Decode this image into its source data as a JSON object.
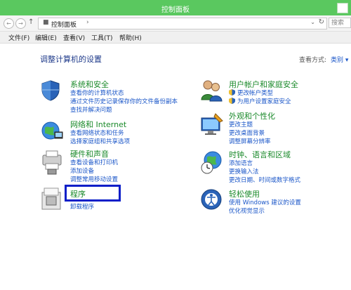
{
  "window": {
    "title": "控制面板"
  },
  "address": {
    "crumb": "控制面板",
    "search_placeholder": "搜索"
  },
  "menu": [
    "文件(F)",
    "编辑(E)",
    "查看(V)",
    "工具(T)",
    "帮助(H)"
  ],
  "content": {
    "heading": "调整计算机的设置",
    "view_by_label": "查看方式:",
    "view_by_value": "类别 ▾"
  },
  "categories": {
    "system": {
      "title": "系统和安全",
      "links": [
        "查看你的计算机状态",
        "通过文件历史记录保存你的文件备份副本",
        "查找并解决问题"
      ]
    },
    "network": {
      "title": "网络和 Internet",
      "links": [
        "查看网络状态和任务",
        "选择家庭组和共享选项"
      ]
    },
    "hardware": {
      "title": "硬件和声音",
      "links": [
        "查看设备和打印机",
        "添加设备",
        "调整常用移动设置"
      ]
    },
    "programs": {
      "title": "程序",
      "links": [
        "卸载程序"
      ]
    },
    "accounts": {
      "title": "用户帐户和家庭安全",
      "links": [
        "更改帐户类型",
        "为用户设置家庭安全"
      ]
    },
    "appearance": {
      "title": "外观和个性化",
      "links": [
        "更改主题",
        "更改桌面背景",
        "调整屏幕分辨率"
      ]
    },
    "clock": {
      "title": "时钟、语言和区域",
      "links": [
        "添加语言",
        "更换输入法",
        "更改日期、时间或数字格式"
      ]
    },
    "ease": {
      "title": "轻松使用",
      "links": [
        "使用 Windows 建议的设置",
        "优化视觉显示"
      ]
    }
  }
}
